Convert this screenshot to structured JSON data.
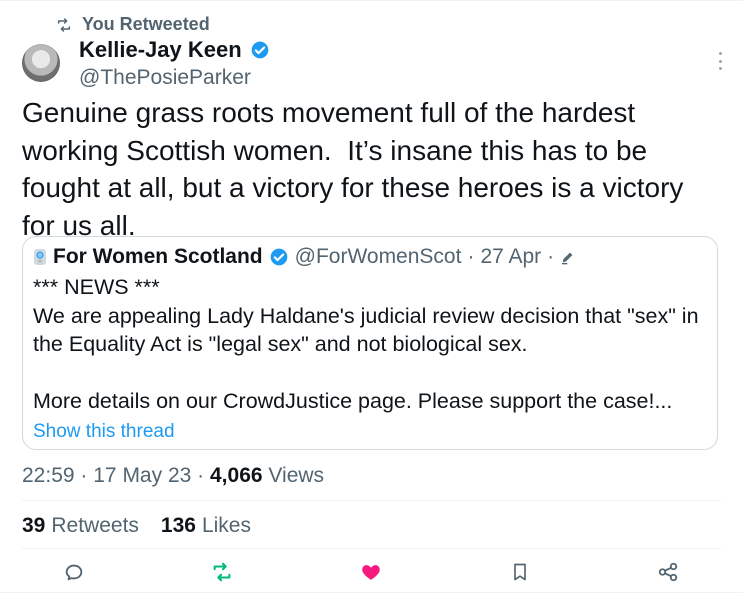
{
  "retweet_banner": "You Retweeted",
  "author": {
    "name": "Kellie-Jay Keen",
    "handle": "@ThePosieParker"
  },
  "tweet_text": "Genuine grass roots movement full of the hardest working Scottish women.  It’s insane this has to be fought at all, but a victory for these heroes is a victory for us all.",
  "quote": {
    "name": "For Women Scotland",
    "handle": "@ForWomenScot",
    "sep1": "·",
    "date": "27 Apr",
    "sep2": "·",
    "body": "*** NEWS ***\nWe are appealing Lady Haldane's judicial review decision that \"sex\" in the Equality Act is \"legal sex\" and not biological sex.\n\nMore details on our CrowdJustice page. Please support the case!...",
    "show_thread": "Show this thread"
  },
  "meta": {
    "time": "22:59",
    "sep1": "·",
    "date": "17 May 23",
    "sep2": "·",
    "views_count": "4,066",
    "views_label": "Views"
  },
  "counts": {
    "retweets_count": "39",
    "retweets_label": "Retweets",
    "likes_count": "136",
    "likes_label": "Likes"
  },
  "icons": {
    "retweet_banner_icon": "retweet-icon",
    "verified_badge": "verified-icon",
    "more": "more-vertical-icon",
    "quote_org_badge": "org-badge-icon",
    "quote_edit": "edit-pencil-icon",
    "reply": "reply-icon",
    "retweet": "retweet-icon",
    "like": "heart-icon",
    "bookmark": "bookmark-icon",
    "share": "share-icon"
  },
  "colors": {
    "accent": "#1d9bf0",
    "retweet_green": "#00ba7c",
    "like_pink": "#f91880",
    "text": "#0f1419",
    "secondary": "#536471"
  }
}
